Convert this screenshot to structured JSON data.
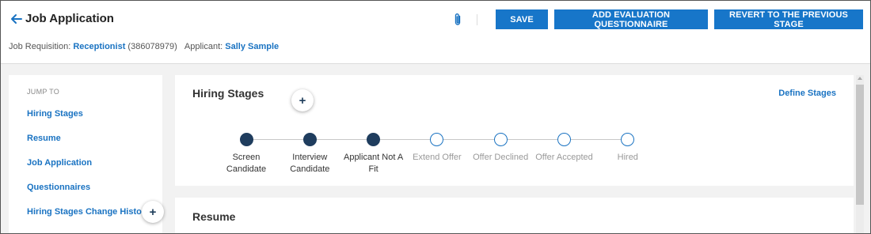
{
  "header": {
    "title": "Job Application",
    "job_requisition_label": "Job Requisition:",
    "job_requisition_value": "Receptionist",
    "job_requisition_id": "(386078979)",
    "applicant_label": "Applicant:",
    "applicant_value": "Sally Sample",
    "buttons": {
      "save": "SAVE",
      "add_eval": "ADD EVALUATION QUESTIONNAIRE",
      "revert": "REVERT TO THE PREVIOUS STAGE"
    }
  },
  "sidebar": {
    "heading": "JUMP TO",
    "items": [
      {
        "label": "Hiring Stages"
      },
      {
        "label": "Resume"
      },
      {
        "label": "Job Application"
      },
      {
        "label": "Questionnaires"
      },
      {
        "label": "Hiring Stages Change History"
      }
    ]
  },
  "hiring_stages": {
    "title": "Hiring Stages",
    "define_link": "Define Stages",
    "stages": [
      {
        "label": "Screen Candidate",
        "completed": true
      },
      {
        "label": "Interview Candidate",
        "completed": true
      },
      {
        "label": "Applicant Not A Fit",
        "completed": true
      },
      {
        "label": "Extend Offer",
        "completed": false
      },
      {
        "label": "Offer Declined",
        "completed": false
      },
      {
        "label": "Offer Accepted",
        "completed": false
      },
      {
        "label": "Hired",
        "completed": false
      }
    ]
  },
  "resume": {
    "title": "Resume"
  },
  "fab_symbol": "+",
  "colors": {
    "primary_button": "#1776c9",
    "link": "#1a73c2",
    "stage_completed": "#1f3d5e",
    "stage_pending_border": "#1a73c2"
  },
  "icons": {
    "back": "arrow-left-icon",
    "attach": "paperclip-icon",
    "add": "plus-icon"
  }
}
